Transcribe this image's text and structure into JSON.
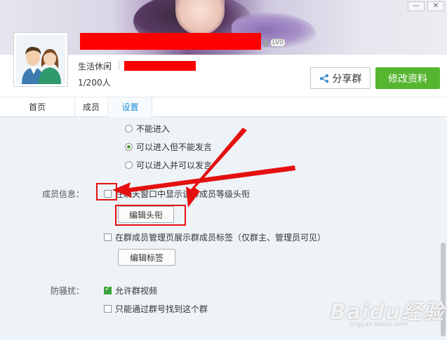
{
  "window": {
    "minimize_label": "—",
    "close_label": "✕"
  },
  "group": {
    "level_badge": "LV0",
    "category": "生活休闲",
    "members": "1/200人"
  },
  "buttons": {
    "share": "分享群",
    "edit": "修改资料",
    "edit_title": "编辑头衔",
    "edit_tag": "编辑标签"
  },
  "tabs": [
    {
      "label": "首页"
    },
    {
      "label": "成员"
    },
    {
      "label": "设置"
    }
  ],
  "settings": {
    "entry_options": [
      {
        "label": "不能进入",
        "checked": false
      },
      {
        "label": "可以进入但不能发言",
        "checked": true
      },
      {
        "label": "可以进入并可以发言",
        "checked": false
      }
    ],
    "member_info_label": "成员信息：",
    "show_title_option": "在聊天窗口中显示该群成员等级头衔",
    "show_tag_option": "在群成员管理页展示群成员标签（仅群主、管理员可见）",
    "anti_harass_label": "防骚扰：",
    "allow_video": "允许群视频",
    "find_by_number": "只能通过群号找到这个群"
  },
  "watermark": {
    "brand": "Baidu经验",
    "site": "jingyan.baidu.com"
  },
  "colors": {
    "accent_green": "#56b630",
    "tab_active": "#1a8bd6",
    "annotation_red": "#e41010"
  }
}
